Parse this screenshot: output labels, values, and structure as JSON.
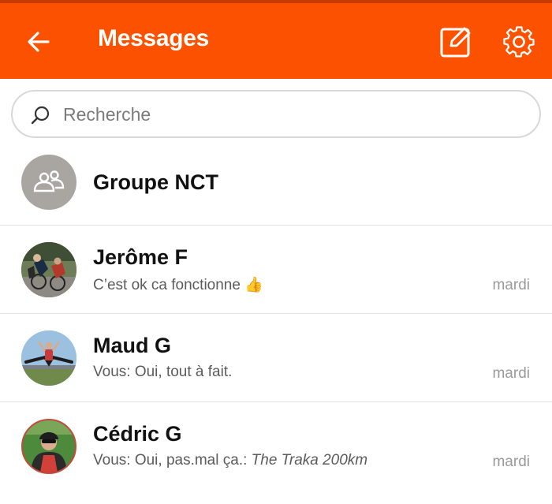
{
  "header": {
    "title": "Messages",
    "back_icon": "arrow-left-icon",
    "compose_icon": "compose-icon",
    "settings_icon": "gear-icon",
    "background_color": "#fc5200"
  },
  "search": {
    "placeholder": "Recherche",
    "value": ""
  },
  "conversations": [
    {
      "name": "Groupe NCT",
      "avatar": "group-icon",
      "preview": "",
      "time": ""
    },
    {
      "name": "Jerôme F",
      "avatar": "photo-cyclists",
      "preview": "C’est ok ca fonctionne",
      "preview_emoji": "👍",
      "time": "mardi"
    },
    {
      "name": "Maud G",
      "avatar": "photo-jump",
      "preview": "Vous: Oui, tout à fait.",
      "time": "mardi"
    },
    {
      "name": "Cédric G",
      "avatar": "photo-cyclist-helmet",
      "preview": "Vous: Oui, pas.mal ça.: ",
      "preview_italic": "The Traka 200km",
      "time": "mardi"
    }
  ]
}
